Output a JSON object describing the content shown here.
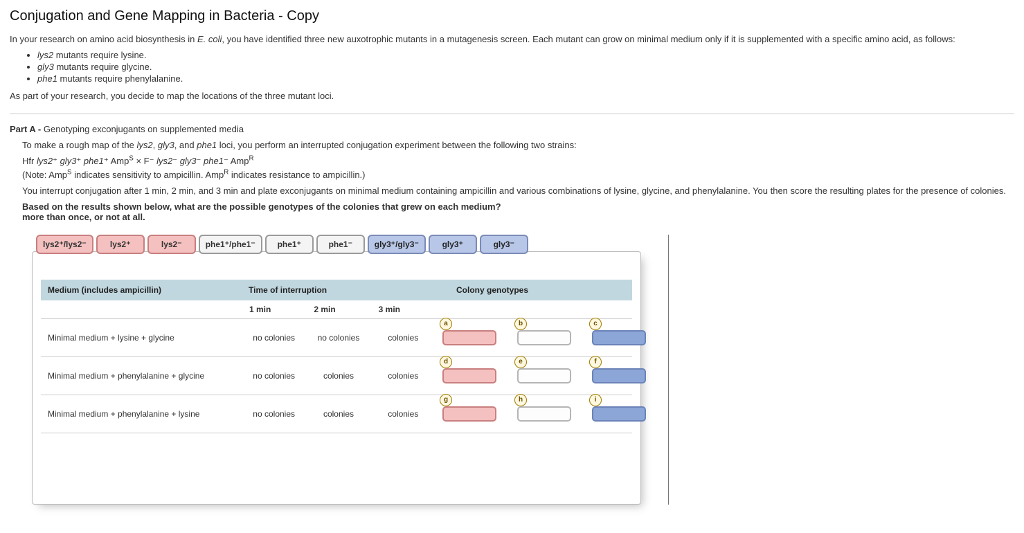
{
  "title": "Conjugation and Gene Mapping in Bacteria - Copy",
  "intro": {
    "prefix": "In your research on amino acid biosynthesis in ",
    "organism": "E. coli",
    "suffix": ", you have identified three new auxotrophic mutants in a mutagenesis screen. Each mutant can grow on minimal medium only if it is supplemented with a specific amino acid, as follows:",
    "bullets": [
      {
        "gene": "lys2",
        "text": " mutants require lysine."
      },
      {
        "gene": "gly3",
        "text": " mutants require glycine."
      },
      {
        "gene": "phe1",
        "text": " mutants require phenylalanine."
      }
    ],
    "closing": "As part of your research, you decide to map the locations of the three mutant loci."
  },
  "partA": {
    "label": "Part A -",
    "heading": " Genotyping exconjugants on supplemented media",
    "p1_a": "To make a rough map of the ",
    "p1_b": ", ",
    "p1_c": ", and ",
    "p1_d": " loci, you perform an interrupted conjugation experiment between the following two strains:",
    "genes": {
      "g1": "lys2",
      "g2": "gly3",
      "g3": "phe1"
    },
    "cross_html": "Hfr <em>lys2</em>⁺ <em>gly3</em>⁺ <em>phe1</em>⁺ Amp<sup>S</sup> × F⁻ <em>lys2</em>⁻ <em>gly3</em>⁻ <em>phe1</em>⁻ Amp<sup>R</sup>",
    "note_html": "(Note: Amp<sup>S</sup> indicates sensitivity to ampicillin. Amp<sup>R</sup> indicates resistance to ampicillin.)",
    "p2": "You interrupt conjugation after 1 min, 2 min, and 3 min and plate exconjugants on minimal medium containing ampicillin and various combinations of lysine, glycine, and phenylalanine. You then score the resulting plates for the presence of colonies.",
    "question1": "Based on the results shown below, what are the possible genotypes of the colonies that grew on each medium?",
    "question2": "more than once, or not at all."
  },
  "tiles": [
    {
      "html": "lys2⁺/lys2⁻",
      "cls": "pink"
    },
    {
      "html": "lys2⁺",
      "cls": "pink"
    },
    {
      "html": "lys2⁻",
      "cls": "pink"
    },
    {
      "html": "phe1⁺/phe1⁻",
      "cls": "gray"
    },
    {
      "html": "phe1⁺",
      "cls": "gray"
    },
    {
      "html": "phe1⁻",
      "cls": "gray"
    },
    {
      "html": "gly3⁺/gly3⁻",
      "cls": "blue"
    },
    {
      "html": "gly3⁺",
      "cls": "blue"
    },
    {
      "html": "gly3⁻",
      "cls": "blue"
    }
  ],
  "table": {
    "headers": {
      "medium": "Medium (includes ampicillin)",
      "time": "Time of interruption",
      "geno": "Colony genotypes"
    },
    "timecols": [
      "1 min",
      "2 min",
      "3 min"
    ],
    "rows": [
      {
        "medium": "Minimal medium + lysine + glycine",
        "cells": [
          "no colonies",
          "no colonies",
          "colonies"
        ],
        "slots": [
          {
            "l": "a",
            "c": "pink"
          },
          {
            "l": "b",
            "c": "gray"
          },
          {
            "l": "c",
            "c": "blue"
          }
        ]
      },
      {
        "medium": "Minimal medium + phenylalanine + glycine",
        "cells": [
          "no colonies",
          "colonies",
          "colonies"
        ],
        "slots": [
          {
            "l": "d",
            "c": "pink"
          },
          {
            "l": "e",
            "c": "gray"
          },
          {
            "l": "f",
            "c": "blue"
          }
        ]
      },
      {
        "medium": "Minimal medium + phenylalanine + lysine",
        "cells": [
          "no colonies",
          "colonies",
          "colonies"
        ],
        "slots": [
          {
            "l": "g",
            "c": "pink"
          },
          {
            "l": "h",
            "c": "gray"
          },
          {
            "l": "i",
            "c": "blue"
          }
        ]
      }
    ]
  }
}
